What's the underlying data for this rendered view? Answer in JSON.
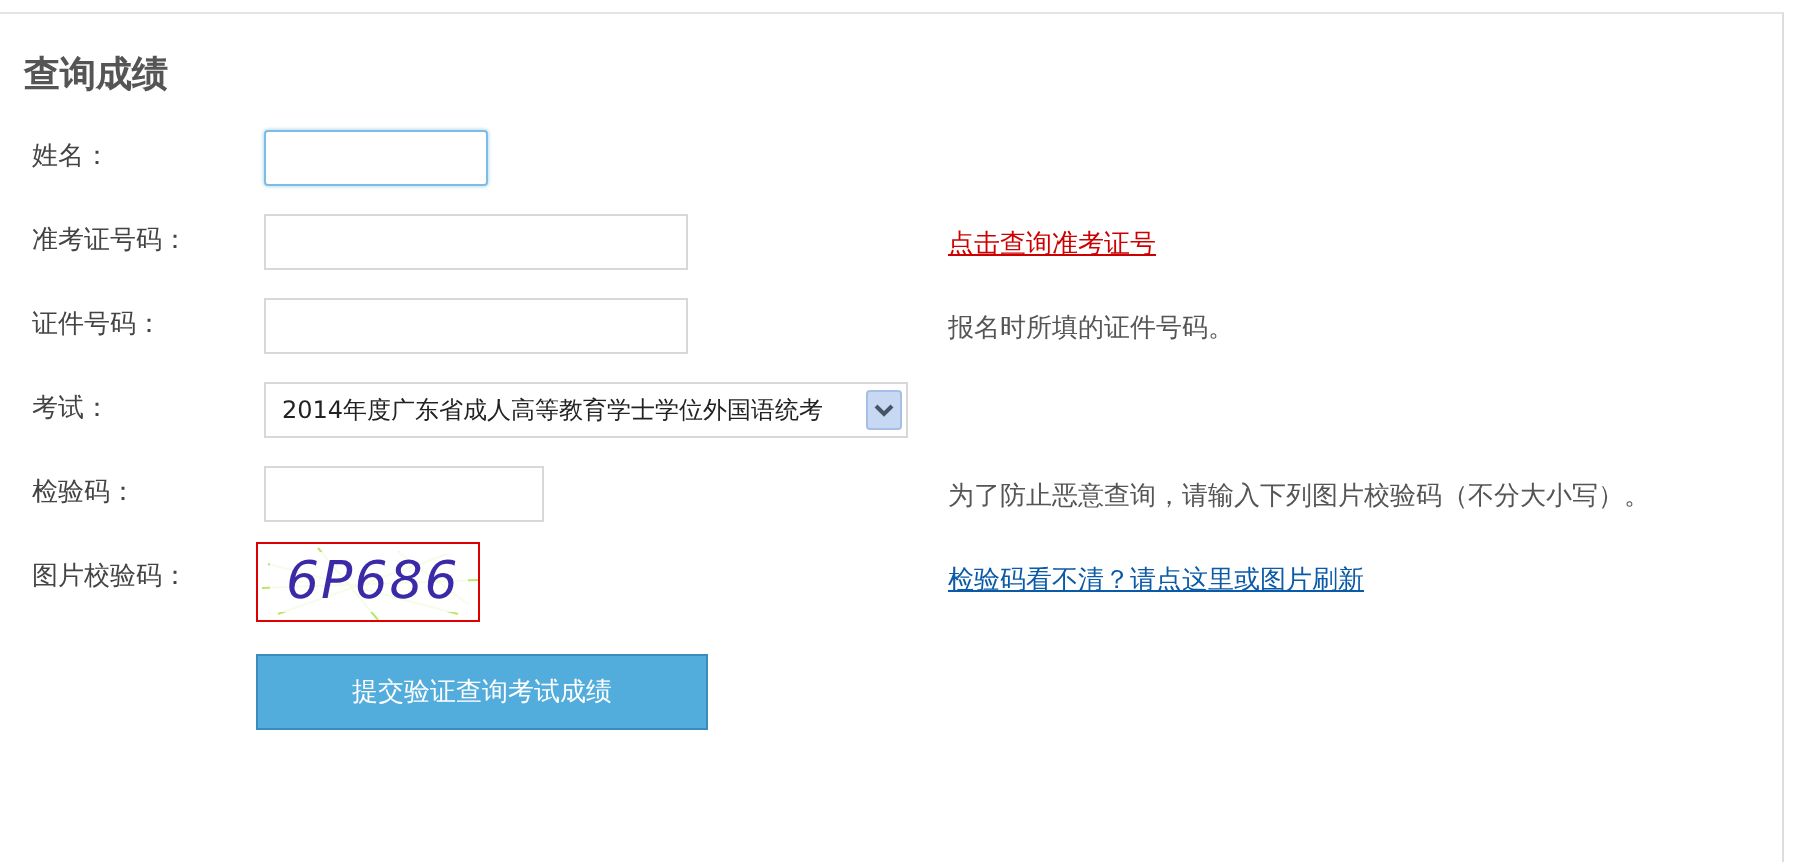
{
  "title": "查询成绩",
  "rows": [
    {
      "label": "姓名：",
      "kind": "input",
      "focused": true
    },
    {
      "label": "准考证号码：",
      "kind": "input",
      "focused": false,
      "note": {
        "kind": "link",
        "text": "点击查询准考证号",
        "color": "#cc0000"
      }
    },
    {
      "label": "证件号码：",
      "kind": "input",
      "focused": false,
      "note": {
        "kind": "text",
        "text": "报名时所填的证件号码。"
      }
    },
    {
      "label": "考试：",
      "kind": "select",
      "value": "2014年度广东省成人高等教育学士学位外国语统考"
    },
    {
      "label": "检验码：",
      "kind": "input",
      "focused": false,
      "note": {
        "kind": "text",
        "text": "为了防止恶意查询，请输入下列图片校验码（不分大小写）。"
      }
    },
    {
      "label": "图片校验码：",
      "kind": "captcha",
      "code": "6P686",
      "note": {
        "kind": "link",
        "text": "检验码看不清？请点这里或图片刷新",
        "color": "#0b5aa8"
      }
    }
  ],
  "submit": "提交验证查询考试成绩"
}
